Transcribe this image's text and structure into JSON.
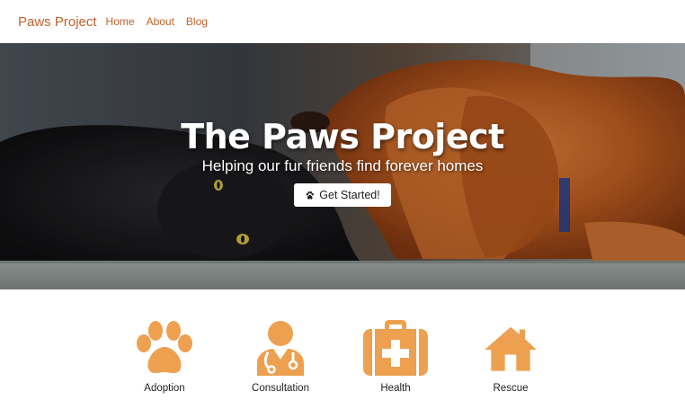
{
  "nav": {
    "brand": "Paws Project",
    "links": [
      "Home",
      "About",
      "Blog"
    ]
  },
  "hero": {
    "title": "The Paws Project",
    "subtitle": "Helping our fur friends find forever homes",
    "cta_label": "Get Started!"
  },
  "services": [
    {
      "label": "Adoption",
      "icon": "paw-icon"
    },
    {
      "label": "Consultation",
      "icon": "doctor-icon"
    },
    {
      "label": "Health",
      "icon": "first-aid-kit-icon"
    },
    {
      "label": "Rescue",
      "icon": "house-icon"
    }
  ],
  "colors": {
    "brand": "#c0622a",
    "icon": "#eda050"
  }
}
